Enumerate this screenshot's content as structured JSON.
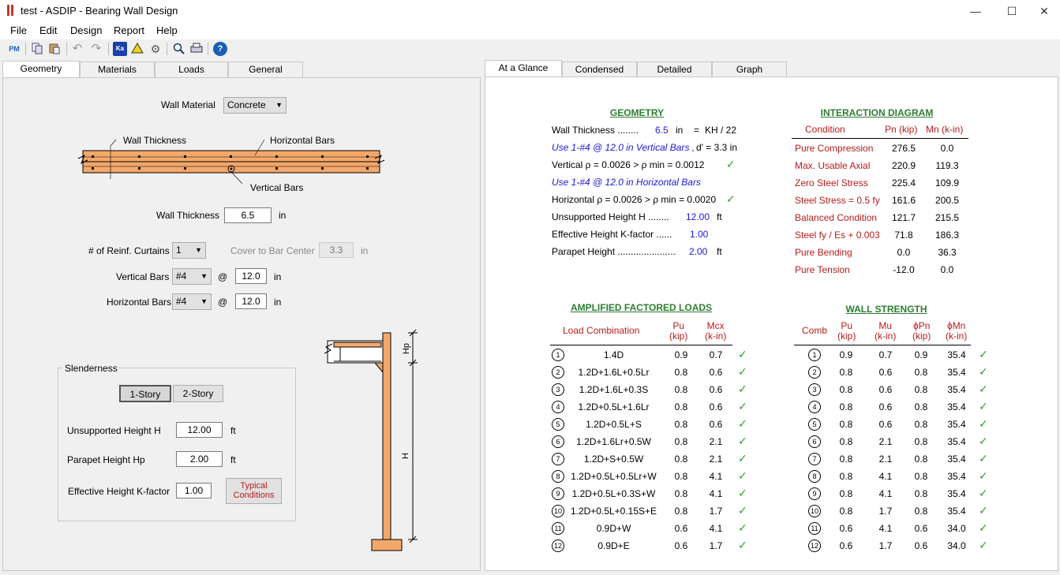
{
  "window": {
    "title": "test - ASDIP - Bearing Wall Design",
    "minimize": "—",
    "maximize": "☐",
    "close": "✕"
  },
  "menu": [
    "File",
    "Edit",
    "Design",
    "Report",
    "Help"
  ],
  "toolbar_icons": [
    "pm-icon",
    "copy-icon",
    "paste-icon",
    "undo-icon",
    "redo-icon",
    "ka-icon",
    "warning-icon",
    "settings-icon",
    "zoom-icon",
    "print-icon",
    "help-icon"
  ],
  "left_tabs": [
    "Geometry",
    "Materials",
    "Loads",
    "General"
  ],
  "right_tabs": [
    "At a Glance",
    "Condensed",
    "Detailed",
    "Graph"
  ],
  "geometry": {
    "wall_material_label": "Wall Material",
    "wall_material": "Concrete",
    "wall_thickness_label": "Wall Thickness",
    "wall_thickness": "6.5",
    "wall_thickness_unit": "in",
    "curtains_label": "# of Reinf. Curtains",
    "curtains": "1",
    "cover_label": "Cover to Bar Center",
    "cover": "3.3",
    "cover_unit": "in",
    "vertical_bars_label": "Vertical Bars",
    "vertical_bars": "#4",
    "vertical_spacing": "12.0",
    "vertical_unit": "in",
    "horizontal_bars_label": "Horizontal Bars",
    "horizontal_bars": "#4",
    "horizontal_spacing": "12.0",
    "horizontal_unit": "in",
    "at": "@",
    "diagram_labels": {
      "wall_thickness": "Wall Thickness",
      "horizontal_bars": "Horizontal Bars",
      "vertical_bars": "Vertical Bars",
      "hp": "Hp",
      "h": "H"
    },
    "slenderness": {
      "group_label": "Slenderness",
      "one_story": "1-Story",
      "two_story": "2-Story",
      "unsupported_label": "Unsupported Height  H",
      "unsupported": "12.00",
      "unsupported_unit": "ft",
      "parapet_label": "Parapet Height  Hp",
      "parapet": "2.00",
      "parapet_unit": "ft",
      "k_label": "Effective Height K-factor",
      "k": "1.00",
      "typical": "Typical Conditions"
    }
  },
  "glance": {
    "geometry_title": "GEOMETRY",
    "wt_label": "Wall Thickness ........",
    "wt_val": "6.5",
    "wt_unit": "in",
    "wt_eq": "=",
    "wt_ratio": "KH / 22",
    "vert_use": "Use 1-#4 @ 12.0 in Vertical Bars ,",
    "d_prime": "d' = 3.3  in",
    "vert_rho": "Vertical ρ = 0.0026    >   ρ min = 0.0012",
    "horiz_use": "Use 1-#4 @ 12.0 in Horizontal Bars",
    "horiz_rho": "Horizontal ρ = 0.0026   >   ρ min = 0.0020",
    "uh_label": "Unsupported Height  H ........",
    "uh_val": "12.00",
    "uh_unit": "ft",
    "k_label": "Effective Height  K-factor ......",
    "k_val": "1.00",
    "ph_label": "Parapet Height ......................",
    "ph_val": "2.00",
    "ph_unit": "ft",
    "check": "✓",
    "interaction_title": "INTERACTION DIAGRAM",
    "interaction_headers": [
      "Condition",
      "Pn (kip)",
      "Mn (k-in)"
    ],
    "interaction_rows": [
      [
        "Pure Compression",
        "276.5",
        "0.0"
      ],
      [
        "Max. Usable Axial",
        "220.9",
        "119.3"
      ],
      [
        "Zero Steel Stress",
        "225.4",
        "109.9"
      ],
      [
        "Steel Stress = 0.5 fy",
        "161.6",
        "200.5"
      ],
      [
        "Balanced Condition",
        "121.7",
        "215.5"
      ],
      [
        "Steel fy / Es + 0.003",
        "71.8",
        "186.3"
      ],
      [
        "Pure Bending",
        "0.0",
        "36.3"
      ],
      [
        "Pure Tension",
        "-12.0",
        "0.0"
      ]
    ],
    "loads_title": "AMPLIFIED FACTORED LOADS",
    "loads_headers": [
      "Load Combination",
      "Pu\n(kip)",
      "Mcx\n(k-in)"
    ],
    "loads_rows": [
      [
        "1",
        "1.4D",
        "0.9",
        "0.7"
      ],
      [
        "2",
        "1.2D+1.6L+0.5Lr",
        "0.8",
        "0.6"
      ],
      [
        "3",
        "1.2D+1.6L+0.3S",
        "0.8",
        "0.6"
      ],
      [
        "4",
        "1.2D+0.5L+1.6Lr",
        "0.8",
        "0.6"
      ],
      [
        "5",
        "1.2D+0.5L+S",
        "0.8",
        "0.6"
      ],
      [
        "6",
        "1.2D+1.6Lr+0.5W",
        "0.8",
        "2.1"
      ],
      [
        "7",
        "1.2D+S+0.5W",
        "0.8",
        "2.1"
      ],
      [
        "8",
        "1.2D+0.5L+0.5Lr+W",
        "0.8",
        "4.1"
      ],
      [
        "9",
        "1.2D+0.5L+0.3S+W",
        "0.8",
        "4.1"
      ],
      [
        "10",
        "1.2D+0.5L+0.15S+E",
        "0.8",
        "1.7"
      ],
      [
        "11",
        "0.9D+W",
        "0.6",
        "4.1"
      ],
      [
        "12",
        "0.9D+E",
        "0.6",
        "1.7"
      ]
    ],
    "strength_title": "WALL STRENGTH",
    "strength_headers": [
      "Comb",
      "Pu\n(kip)",
      "Mu\n(k-in)",
      "ϕPn\n(kip)",
      "ϕMn\n(k-in)"
    ],
    "strength_rows": [
      [
        "1",
        "0.9",
        "0.7",
        "0.9",
        "35.4"
      ],
      [
        "2",
        "0.8",
        "0.6",
        "0.8",
        "35.4"
      ],
      [
        "3",
        "0.8",
        "0.6",
        "0.8",
        "35.4"
      ],
      [
        "4",
        "0.8",
        "0.6",
        "0.8",
        "35.4"
      ],
      [
        "5",
        "0.8",
        "0.6",
        "0.8",
        "35.4"
      ],
      [
        "6",
        "0.8",
        "2.1",
        "0.8",
        "35.4"
      ],
      [
        "7",
        "0.8",
        "2.1",
        "0.8",
        "35.4"
      ],
      [
        "8",
        "0.8",
        "4.1",
        "0.8",
        "35.4"
      ],
      [
        "9",
        "0.8",
        "4.1",
        "0.8",
        "35.4"
      ],
      [
        "10",
        "0.8",
        "1.7",
        "0.8",
        "35.4"
      ],
      [
        "11",
        "0.6",
        "4.1",
        "0.6",
        "34.0"
      ],
      [
        "12",
        "0.6",
        "1.7",
        "0.6",
        "34.0"
      ]
    ]
  }
}
